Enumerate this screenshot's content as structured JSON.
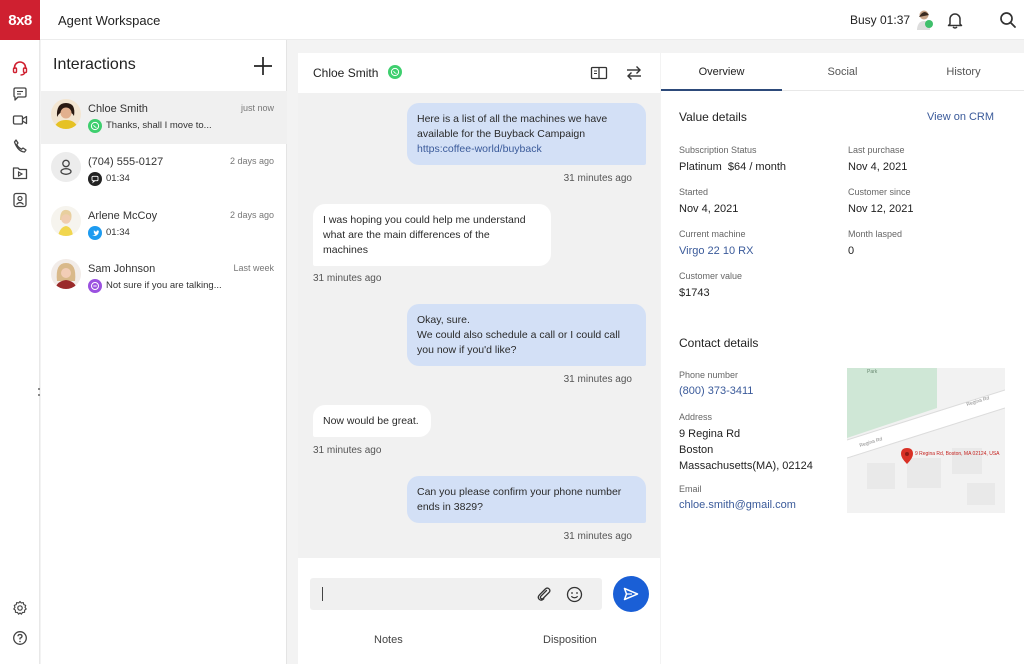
{
  "app": {
    "logo_text": "8x8",
    "title": "Agent Workspace",
    "status": "Busy 01:37",
    "brand_color": "#cf2030"
  },
  "topbar_icons": [
    "agent-avatar",
    "bell-icon",
    "search-icon"
  ],
  "rail": {
    "items": [
      {
        "name": "headset-icon",
        "active": true
      },
      {
        "name": "chat-icon"
      },
      {
        "name": "video-icon"
      },
      {
        "name": "phone-icon"
      },
      {
        "name": "folder-video-icon"
      },
      {
        "name": "contact-card-icon"
      }
    ],
    "bottom": [
      {
        "name": "gear-icon"
      },
      {
        "name": "help-icon"
      }
    ]
  },
  "interactions": {
    "title": "Interactions",
    "items": [
      {
        "name": "Chloe Smith",
        "time": "just now",
        "channel": "whatsapp",
        "preview": "Thanks, shall I move to...",
        "active": true
      },
      {
        "name": "(704) 555-0127",
        "time": "2 days ago",
        "channel": "chat",
        "preview": "01:34"
      },
      {
        "name": "Arlene McCoy",
        "time": "2 days ago",
        "channel": "twitter",
        "preview": "01:34"
      },
      {
        "name": "Sam Johnson",
        "time": "Last week",
        "channel": "messenger",
        "preview": "Not sure if you are talking..."
      }
    ]
  },
  "chat": {
    "contact_name": "Chloe Smith",
    "messages": [
      {
        "direction": "out",
        "lines": [
          "Here is a list of all the machines we have",
          "available for the Buyback Campaign"
        ],
        "link": "https:coffee-world/buyback",
        "time": "31 minutes ago"
      },
      {
        "direction": "in",
        "lines": [
          "I was hoping you could help me understand",
          "what are the main differences of the",
          "machines"
        ],
        "time": "31 minutes ago"
      },
      {
        "direction": "out",
        "lines": [
          "Okay, sure.",
          "We could also schedule a call or I could call",
          "you now if you'd like?"
        ],
        "time": "31 minutes ago"
      },
      {
        "direction": "in",
        "lines": [
          "Now would be great."
        ],
        "time": "31 minutes ago"
      },
      {
        "direction": "out",
        "lines": [
          "Can you please confirm your phone number",
          "ends in 3829?"
        ],
        "time": "31 minutes ago"
      }
    ],
    "input_value": "",
    "tabs": [
      "Notes",
      "Disposition"
    ],
    "send_color": "#1a5fd6"
  },
  "details": {
    "tabs": [
      "Overview",
      "Social",
      "History"
    ],
    "active_tab": "Overview",
    "value_details": {
      "title": "Value details",
      "crm_link": "View on CRM",
      "fields": {
        "subscription_status": {
          "label": "Subscription Status",
          "value": "Platinum  $64 / month"
        },
        "last_purchase": {
          "label": "Last purchase",
          "value": "Nov 4, 2021"
        },
        "started": {
          "label": "Started",
          "value": "Nov 4, 2021"
        },
        "customer_since": {
          "label": "Customer since",
          "value": "Nov 12, 2021"
        },
        "current_machine": {
          "label": "Current machine",
          "value": "Virgo 22 10 RX"
        },
        "month_lapsed": {
          "label": "Month lasped",
          "value": "0"
        },
        "customer_value": {
          "label": "Customer value",
          "value": "$1743"
        }
      }
    },
    "contact_details": {
      "title": "Contact details",
      "phone": {
        "label": "Phone number",
        "value": "(800) 373-3411"
      },
      "address": {
        "label": "Address",
        "lines": [
          "9 Regina Rd",
          "Boston",
          "Massachusetts(MA), 02124"
        ]
      },
      "email": {
        "label": "Email",
        "value": "chloe.smith@gmail.com"
      },
      "map": {
        "park_label": "Park",
        "road_label": "Regina Rd",
        "pin_label": "9 Regina Rd, Boston, MA 02124, USA"
      }
    }
  }
}
